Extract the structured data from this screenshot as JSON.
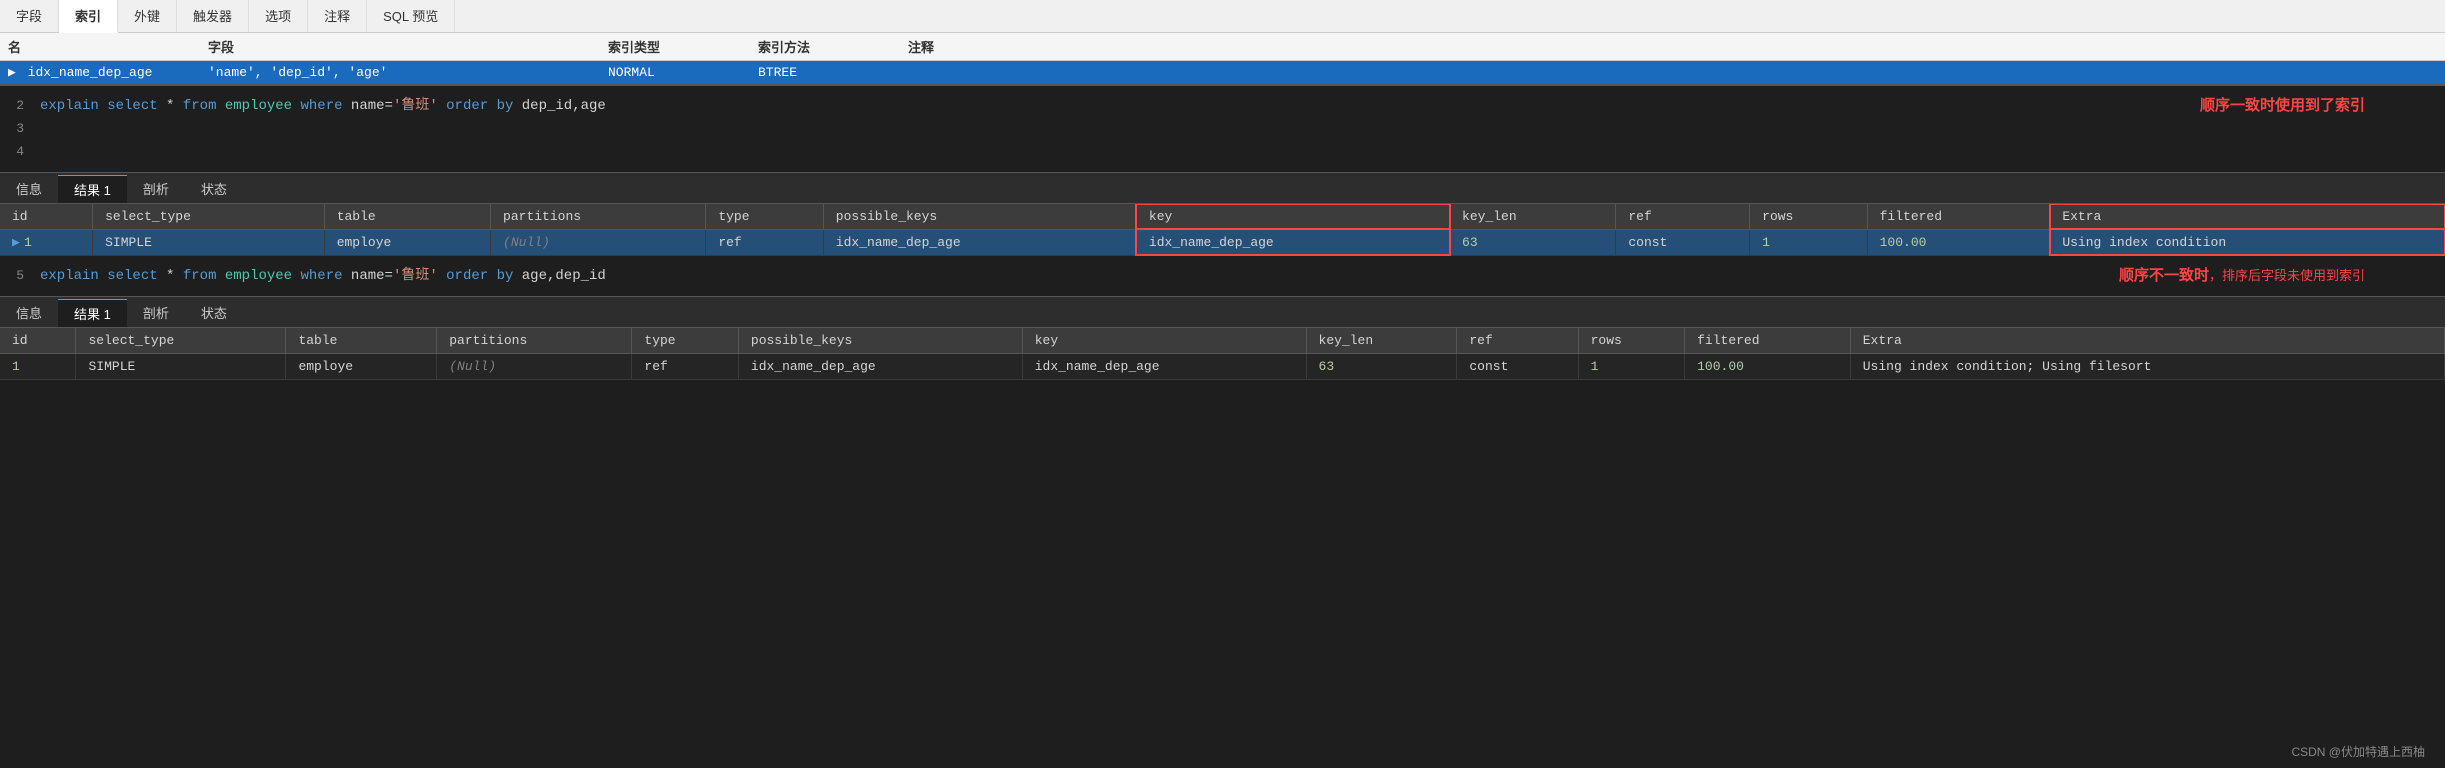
{
  "tabs": {
    "items": [
      "字段",
      "索引",
      "外键",
      "触发器",
      "选项",
      "注释",
      "SQL 预览"
    ],
    "active": "索引"
  },
  "index_table": {
    "headers": [
      "名",
      "字段",
      "索引类型",
      "索引方法",
      "注释"
    ],
    "rows": [
      {
        "name": "idx_name_dep_age",
        "fields": "'name', 'dep_id', 'age'",
        "type": "NORMAL",
        "method": "BTREE",
        "comment": ""
      }
    ]
  },
  "sql_block1": {
    "lines": [
      {
        "num": "2",
        "code": "explain select * from employee where name='鲁班' order by dep_id,age"
      },
      {
        "num": "3",
        "code": ""
      },
      {
        "num": "4",
        "code": ""
      }
    ],
    "annotation": "顺序一致时使用到了索引"
  },
  "result_tabs1": [
    "信息",
    "结果 1",
    "剖析",
    "状态"
  ],
  "result_active1": "结果 1",
  "result_table1": {
    "headers": [
      "id",
      "select_type",
      "table",
      "partitions",
      "type",
      "possible_keys",
      "key",
      "key_len",
      "ref",
      "rows",
      "filtered",
      "Extra"
    ],
    "rows": [
      {
        "id": "1",
        "select_type": "SIMPLE",
        "table": "employe",
        "partitions": "(Null)",
        "type": "ref",
        "possible_keys": "idx_name_dep_age",
        "key": "idx_name_dep_age",
        "key_len": "63",
        "ref": "const",
        "rows": "1",
        "filtered": "100.00",
        "extra": "Using index condition"
      }
    ]
  },
  "sql_block2": {
    "lines": [
      {
        "num": "5",
        "code": "explain select * from employee where name='鲁班' order by age,dep_id"
      }
    ],
    "annotation": "顺序不一致时，排序后字段未使用到索引"
  },
  "result_tabs2": [
    "信息",
    "结果 1",
    "剖析",
    "状态"
  ],
  "result_active2": "结果 1",
  "result_table2": {
    "headers": [
      "id",
      "select_type",
      "table",
      "partitions",
      "type",
      "possible_keys",
      "key",
      "key_len",
      "ref",
      "rows",
      "filtered",
      "Extra"
    ],
    "rows": [
      {
        "id": "1",
        "select_type": "SIMPLE",
        "table": "employe",
        "partitions": "(Null)",
        "type": "ref",
        "possible_keys": "idx_name_dep_age",
        "key": "idx_name_dep_age",
        "key_len": "63",
        "ref": "const",
        "rows": "1",
        "filtered": "100.00",
        "extra": "Using index condition; Using filesort"
      }
    ]
  },
  "watermark": "CSDN @伏加特遇上西柚"
}
